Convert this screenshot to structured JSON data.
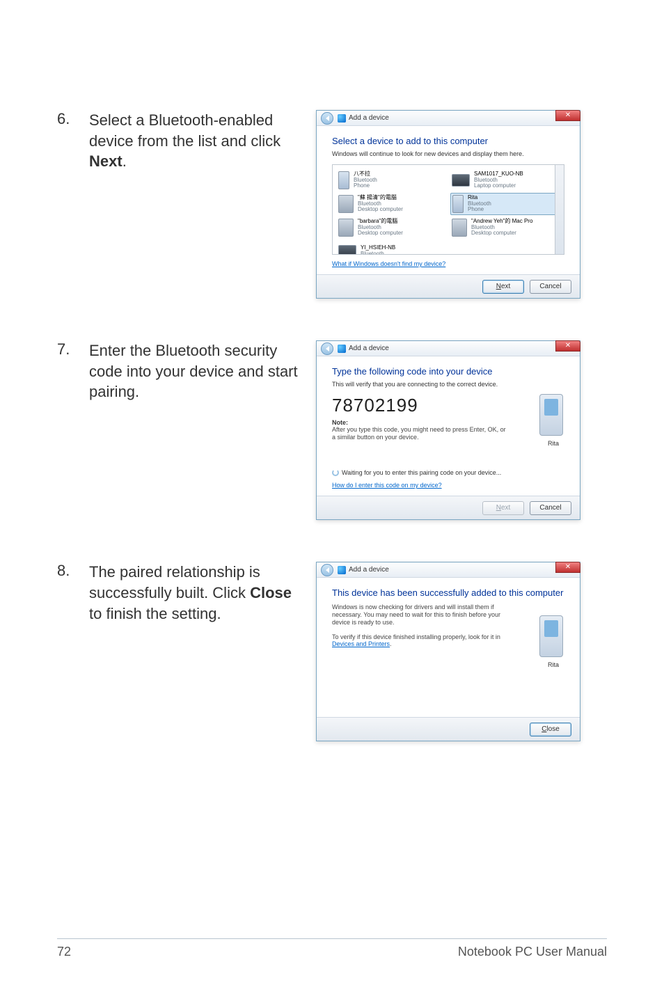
{
  "steps": {
    "s6": {
      "num": "6.",
      "text_before": "Select a Bluetooth-enabled device from the list and click ",
      "bold": "Next",
      "text_after": "."
    },
    "s7": {
      "num": "7.",
      "text": "Enter the Bluetooth security code into your device and start pairing."
    },
    "s8": {
      "num": "8.",
      "text_before": "The paired relationship is successfully built. Click ",
      "bold": "Close",
      "text_after": " to finish the setting."
    }
  },
  "dialog_common": {
    "title": "Add a device",
    "close_glyph": "✕"
  },
  "dlg1": {
    "headline": "Select a device to add to this computer",
    "sub": "Windows will continue to look for new devices and display them here.",
    "devices": [
      {
        "name": "八不拉",
        "l2": "Bluetooth",
        "l3": "Phone",
        "icon": "phone"
      },
      {
        "name": "SAM1017_KUO-NB",
        "l2": "Bluetooth",
        "l3": "Laptop computer",
        "icon": "laptop"
      },
      {
        "name": "\"蘇 揚清\"的電腦",
        "l2": "Bluetooth",
        "l3": "Desktop computer",
        "icon": "desktop"
      },
      {
        "name": "Rita",
        "l2": "Bluetooth",
        "l3": "Phone",
        "icon": "phone",
        "selected": true
      },
      {
        "name": "\"barbara\"的電腦",
        "l2": "Bluetooth",
        "l3": "Desktop computer",
        "icon": "desktop"
      },
      {
        "name": "\"Andrew Yeh\"的 Mac Pro",
        "l2": "Bluetooth",
        "l3": "Desktop computer",
        "icon": "desktop"
      },
      {
        "name": "YI_HSIEH-NB",
        "l2": "Bluetooth",
        "l3": "",
        "icon": "laptop"
      }
    ],
    "link": "What if Windows doesn't find my device?",
    "next": "Next",
    "cancel": "Cancel"
  },
  "dlg2": {
    "headline": "Type the following code into your device",
    "sub": "This will verify that you are connecting to the correct device.",
    "code": "78702199",
    "note_label": "Note:",
    "note_text": "After you type this code, you might need to press Enter, OK, or a similar button on your device.",
    "phone_caption": "Rita",
    "waiting": "Waiting for you to enter this pairing code on your device...",
    "link": "How do I enter this code on my device?",
    "next": "Next",
    "cancel": "Cancel"
  },
  "dlg3": {
    "headline": "This device has been successfully added to this computer",
    "para1": "Windows is now checking for drivers and will install them if necessary. You may need to wait for this to finish before your device is ready to use.",
    "para2_before": "To verify if this device finished installing properly, look for it in ",
    "para2_link": "Devices and Printers",
    "para2_after": ".",
    "phone_caption": "Rita",
    "close": "Close"
  },
  "footer": {
    "page": "72",
    "title": "Notebook PC User Manual"
  }
}
